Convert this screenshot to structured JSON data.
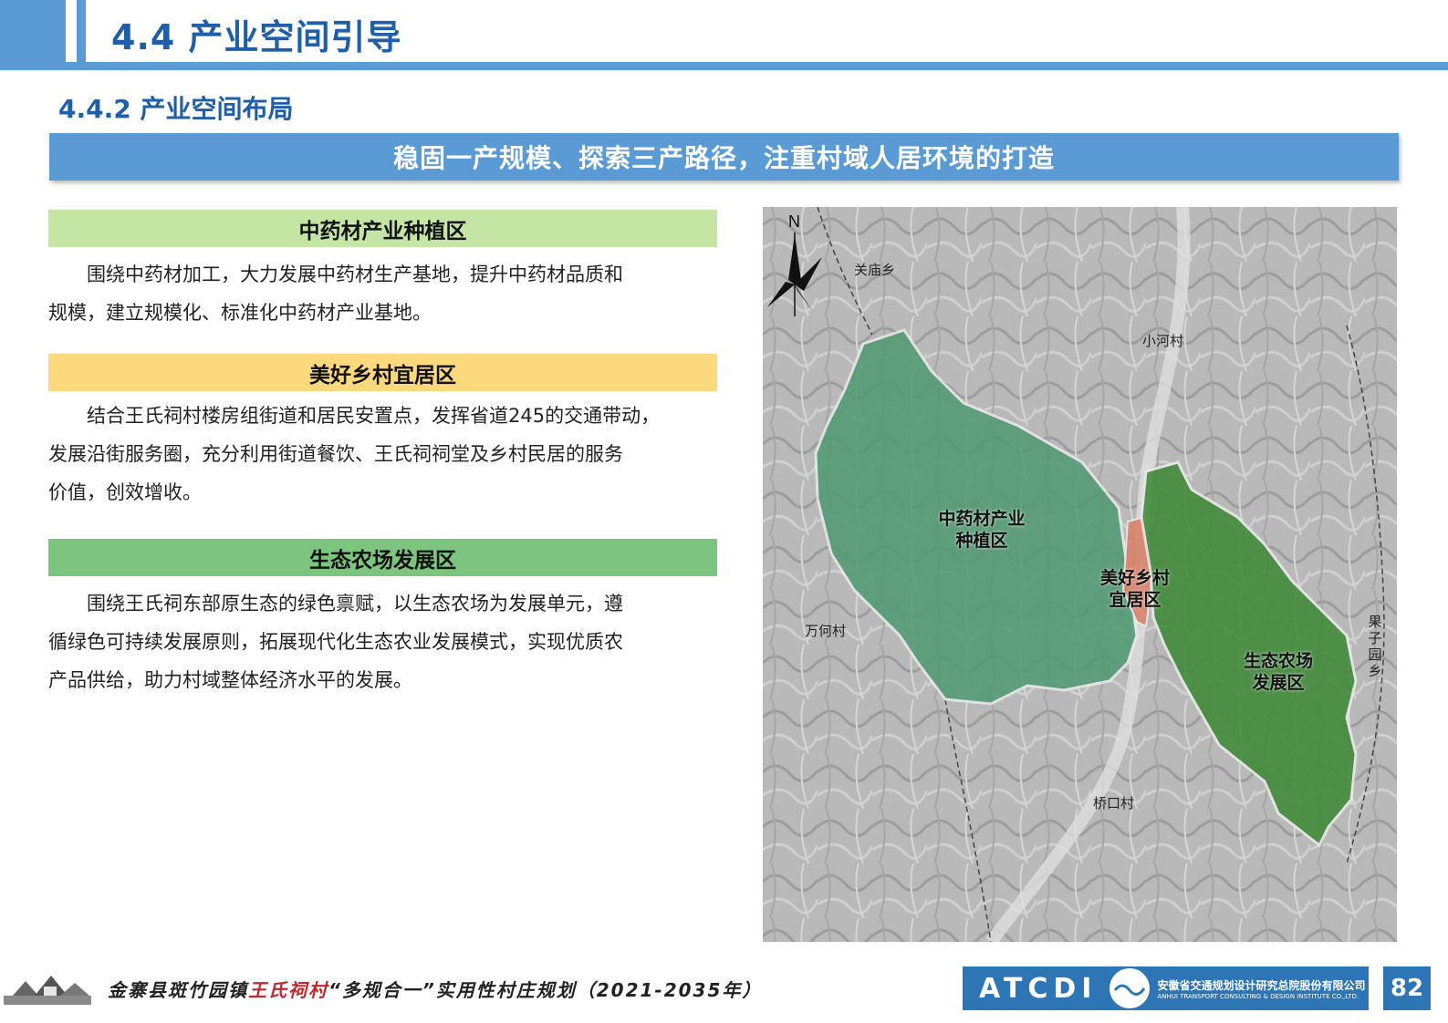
{
  "header": {
    "title": "4.4 产业空间引导",
    "subtitle": "4.4.2 产业空间布局",
    "banner": "稳固一产规模、探索三产路径，注重村域人居环境的打造"
  },
  "zones": [
    {
      "title": "中药材产业种植区",
      "color": "#c5e5a5",
      "lines": [
        "　　围绕中药材加工，大力发展中药材生产基地，提升中药材品质和",
        "规模，建立规模化、标准化中药材产业基地。"
      ]
    },
    {
      "title": "美好乡村宜居区",
      "color": "#fbd97c",
      "lines": [
        "　　结合王氏祠村楼房组街道和居民安置点，发挥省道245的交通带动，",
        "发展沿街服务圈，充分利用街道餐饮、王氏祠祠堂及乡村民居的服务",
        "价值，创效增收。"
      ]
    },
    {
      "title": "生态农场发展区",
      "color": "#7dc47f",
      "lines": [
        "　　围绕王氏祠东部原生态的绿色禀赋，以生态农场为发展单元，遵",
        "循绿色可持续发展原则，拓展现代化生态农业发展模式，实现优质农",
        "产品供给，助力村域整体经济水平的发展。"
      ]
    }
  ],
  "map": {
    "north_label": "N",
    "place_labels": [
      "关庙乡",
      "小河村",
      "万何村",
      "桥口村"
    ],
    "vertical_label": "果子园乡",
    "zone_labels": [
      {
        "line1": "中药材产业",
        "line2": "种植区"
      },
      {
        "line1": "美好乡村",
        "line2": "宜居区"
      },
      {
        "line1": "生态农场",
        "line2": "发展区"
      }
    ],
    "zone_colors": {
      "herb": "#4f9a72",
      "residential": "#d9836a",
      "eco": "#3f8a38"
    }
  },
  "footer": {
    "text_part1": "金寨县斑竹园镇",
    "text_red": "王氏祠村",
    "text_part2": "“多规合一”实用性村庄规划（2021-2035年）",
    "logo_word": "ATCDI",
    "org_name_cn": "安徽省交通规划设计研究总院股份有限公司",
    "org_name_en": "ANHUI TRANSPORT CONSULTING & DESIGN INSTITUTE CO.,LTD.",
    "page_number": "82"
  }
}
